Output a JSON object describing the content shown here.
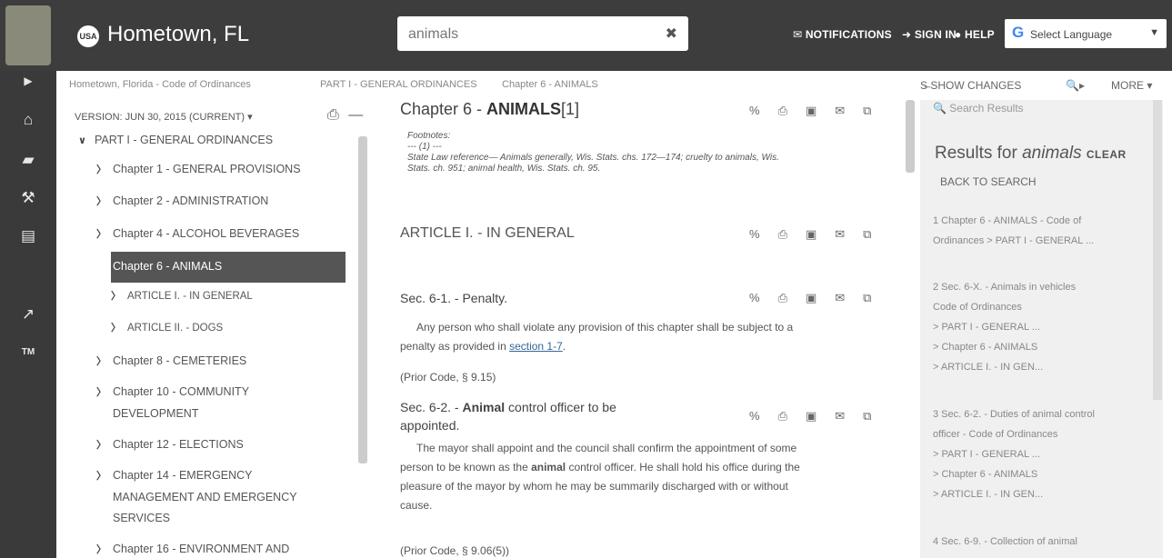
{
  "app": {
    "title": "Hometown, FL",
    "brand_badge": "USA"
  },
  "search": {
    "value": "animals",
    "clear_label": "✖"
  },
  "top_nav": {
    "notifications": "NOTIFICATIONS",
    "sign_in": "SIGN IN",
    "help": "HELP",
    "language": "Select Language"
  },
  "breadcrumb": {
    "items": [
      "Hometown, Florida - Code of Ordinances",
      "PART I - GENERAL ORDINANCES",
      "Chapter 6 - ANIMALS"
    ],
    "show_changes": "SHOW CHANGES",
    "more": "MORE"
  },
  "toc": {
    "version": "VERSION: JUN 30, 2015 (CURRENT)",
    "items": [
      {
        "label": "PART I - GENERAL ORDINANCES",
        "chev": "v"
      },
      {
        "label": "Chapter 1 - GENERAL PROVISIONS",
        "chev": ">"
      },
      {
        "label": "Chapter 2 - ADMINISTRATION",
        "chev": ">"
      },
      {
        "label": "Chapter 4 - ALCOHOL BEVERAGES",
        "chev": ">"
      },
      {
        "label": "Chapter 6 - ANIMALS",
        "chev": "v"
      },
      {
        "label": "ARTICLE I. - IN GENERAL",
        "chev": ">"
      },
      {
        "label": "ARTICLE II. - DOGS",
        "chev": ">"
      },
      {
        "label": "Chapter 8 - CEMETERIES",
        "chev": ">"
      },
      {
        "label": "Chapter 10 - COMMUNITY",
        "label2": "DEVELOPMENT",
        "chev": ">"
      },
      {
        "label": "Chapter 12 - ELECTIONS",
        "chev": ">"
      },
      {
        "label": "Chapter 14 - EMERGENCY",
        "label2": "MANAGEMENT AND EMERGENCY",
        "label3": "SERVICES",
        "chev": ">"
      },
      {
        "label": "Chapter 16 - ENVIRONMENT AND",
        "chev": ">"
      }
    ]
  },
  "content": {
    "chapter_prefix": "Chapter 6 - ",
    "chapter_bold": "ANIMALS",
    "chapter_suffix": "[1]",
    "footnotes_label": "Footnotes:",
    "footnote_marker": "--- (1) ---",
    "footnote_text1": "State Law reference— Animals generally, Wis. Stats. chs. 172—174; cruelty to animals, Wis.",
    "footnote_text2": "Stats. ch. 951; animal health, Wis. Stats. ch. 95.",
    "article_title": "ARTICLE I. - IN GENERAL",
    "sec1_title": "Sec. 6-1. - Penalty.",
    "sec1_text1": "Any person who shall violate any provision of this chapter shall be subject to a",
    "sec1_text2_prefix": "penalty as provided in ",
    "sec1_link": "section 1-7",
    "sec1_prior": "(Prior Code, § 9.15)",
    "sec2_title_prefix": "Sec. 6-2. - ",
    "sec2_title_bold": "Animal",
    "sec2_title_suffix": " control officer to be",
    "sec2_title_line2": "appointed.",
    "sec2_text1_prefix": "The mayor shall appoint and the council shall confirm the appointment of some",
    "sec2_text2_prefix": "person to be known as the ",
    "sec2_text2_bold": "animal",
    "sec2_text2_suffix": " control officer. He shall hold his office during the",
    "sec2_text3": "pleasure of the mayor by whom he may be summarily discharged with or without",
    "sec2_text4": "cause.",
    "sec2_prior": "(Prior Code, § 9.06(5))"
  },
  "results": {
    "search_placeholder": "Search Results",
    "title_prefix": "Results for ",
    "title_term": "animals",
    "clear": "CLEAR",
    "back": "BACK TO SEARCH",
    "items": [
      {
        "l1": "1   Chapter 6 - ANIMALS  -  Code of",
        "l2": "Ordinances > PART I - GENERAL ..."
      },
      {
        "l1": "2   Sec. 6-X. - Animals in vehicles",
        "l2": "    Code of Ordinances",
        "l3": "> PART I - GENERAL ...",
        "l4": "> Chapter 6 - ANIMALS",
        "l5": "> ARTICLE I. - IN GEN..."
      },
      {
        "l1": "3   Sec. 6-2. - Duties of animal control",
        "l2": "officer  -  Code of Ordinances",
        "l3": "> PART I - GENERAL ...",
        "l4": "> Chapter 6 - ANIMALS",
        "l5": "> ARTICLE I. - IN GEN..."
      },
      {
        "l1": "4   Sec. 6-9. - Collection of animal"
      }
    ]
  },
  "colors": {
    "topbar": "#3d3d3d",
    "rail": "#3a3a3a",
    "selected": "#555555",
    "panel": "#f0f0f0"
  }
}
